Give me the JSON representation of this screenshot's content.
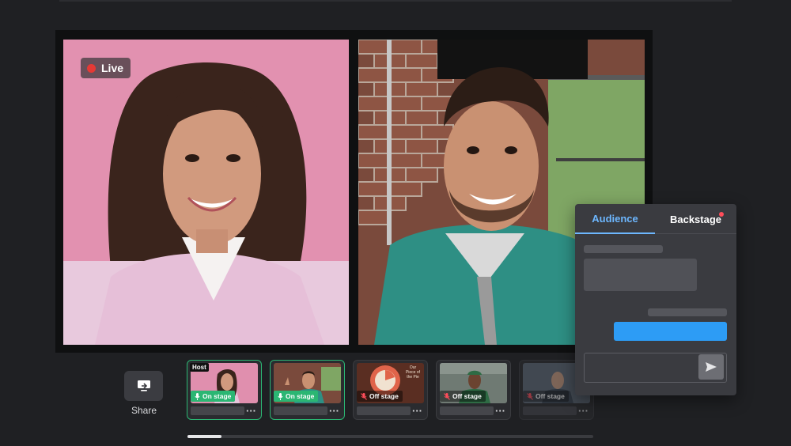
{
  "stage": {
    "live_label": "Live"
  },
  "controls": {
    "share_label": "Share"
  },
  "participants": [
    {
      "tag": "Host",
      "status": "On stage"
    },
    {
      "tag": "",
      "status": "On stage"
    },
    {
      "tag": "",
      "status": "Off stage",
      "caption": "Our Piece of the Pie"
    },
    {
      "tag": "",
      "status": "Off stage"
    },
    {
      "tag": "",
      "status": "Off stage"
    }
  ],
  "chat": {
    "tabs": [
      "Audience",
      "Backstage"
    ],
    "active_tab": "Audience"
  },
  "colors": {
    "on_stage": "#2bb673",
    "accent": "#6db7ff",
    "message": "#2d9cf5",
    "live": "#e53935",
    "notification": "#ff4d5a"
  }
}
